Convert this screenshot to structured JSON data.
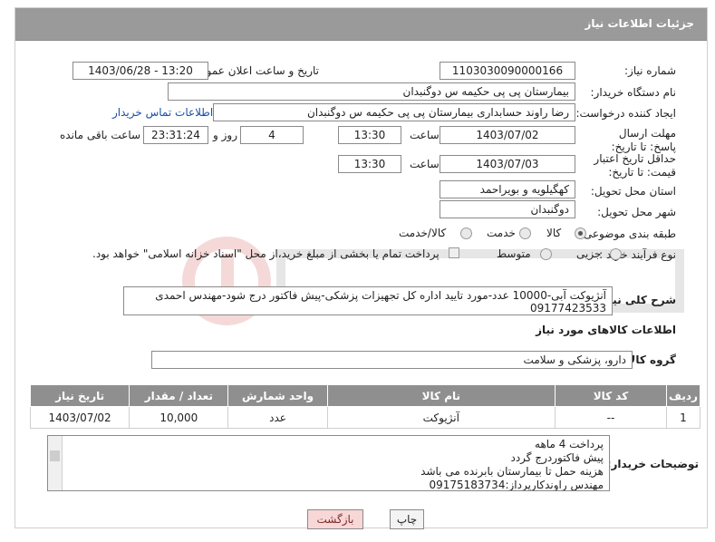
{
  "page": {
    "title": "جزئیات اطلاعات نیاز"
  },
  "fields": {
    "need_number_label": "شماره نیاز:",
    "need_number": "1103030090000166",
    "announce_label": "تاریخ و ساعت اعلان عمومی:",
    "announce_value": "1403/06/28 - 13:20",
    "buyer_org_label": "نام دستگاه خریدار:",
    "buyer_org": "بیمارستان پی پی حکیمه س  دوگنبدان",
    "creator_label": "ایجاد کننده درخواست:",
    "creator": "رضا راوند حسابداری بیمارستان پی پی حکیمه س  دوگنبدان",
    "contact_link": "اطلاعات تماس خریدار",
    "deadline_label": "مهلت ارسال پاسخ: تا تاریخ:",
    "deadline_date": "1403/07/02",
    "time_label": "ساعت",
    "deadline_time": "13:30",
    "days_value": "4",
    "days_label": "روز و",
    "remaining_time": "23:31:24",
    "remaining_label": "ساعت باقی مانده",
    "validity_label": "حداقل تاریخ اعتبار قیمت: تا تاریخ:",
    "validity_date": "1403/07/03",
    "validity_time": "13:30",
    "province_label": "استان محل تحویل:",
    "province": "کهگیلویه و بویراحمد",
    "city_label": "شهر محل تحویل:",
    "city": "دوگنبدان",
    "category_label": "طبقه بندی موضوعی:",
    "category_options": [
      "کالا",
      "خدمت",
      "کالا/خدمت"
    ],
    "process_label": "نوع فرآیند خرید :",
    "process_options": [
      "جزیی",
      "متوسط"
    ],
    "payment_note": "پرداخت تمام یا بخشی از مبلغ خرید،از محل \"اسناد خزانه اسلامی\" خواهد بود.",
    "description_label": "شرح کلی نیاز:",
    "description_line1": "آنژیوکت آبی-10000 عدد-مورد تایید اداره کل تجهیزات پزشکی-پیش فاکتور درج شود-مهندس احمدی",
    "description_line2": "09177423533"
  },
  "goods_section": {
    "title": "اطلاعات کالاهای مورد نیاز",
    "group_label": "گروه کالا:",
    "group_value": "دارو، پزشکی و سلامت"
  },
  "table": {
    "headers": [
      "ردیف",
      "کد کالا",
      "نام کالا",
      "واحد شمارش",
      "تعداد / مقدار",
      "تاریخ نیاز"
    ],
    "rows": [
      [
        "1",
        "--",
        "آنژیوکت",
        "عدد",
        "10,000",
        "1403/07/02"
      ]
    ]
  },
  "notes": {
    "label": "توضیحات خریدار:",
    "lines": [
      "پرداخت 4 ماهه",
      "پیش فاکتوردرج گردد",
      "هزینه حمل تا بیمارستان بابرنده می باشد",
      "مهندس راوندکارپرداز:09175183734"
    ]
  },
  "buttons": {
    "print": "چاپ",
    "back": "بازگشت"
  },
  "colors": {
    "header": "#9a9a9a",
    "table_header": "#8f8f8f",
    "link": "#1a4fa8",
    "back_button": "#f8d7d7"
  }
}
